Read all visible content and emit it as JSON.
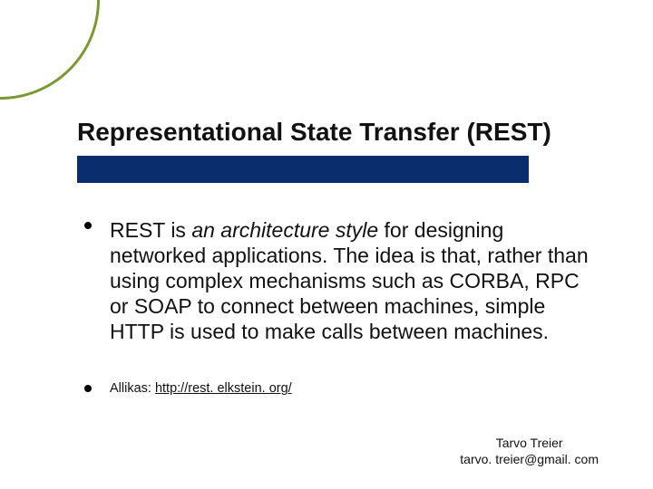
{
  "title": "Representational State Transfer (REST)",
  "bullets": {
    "main_pre": "REST is ",
    "main_italic": "an architecture style",
    "main_post": " for designing networked applications. The idea is that, rather than using complex mechanisms such as CORBA, RPC or SOAP to connect between machines, simple HTTP is used to make calls between machines.",
    "source_label": "Allikas: ",
    "source_link": "http://rest. elkstein. org/"
  },
  "footer": {
    "name": "Tarvo Treier",
    "email": "tarvo. treier@gmail. com"
  }
}
